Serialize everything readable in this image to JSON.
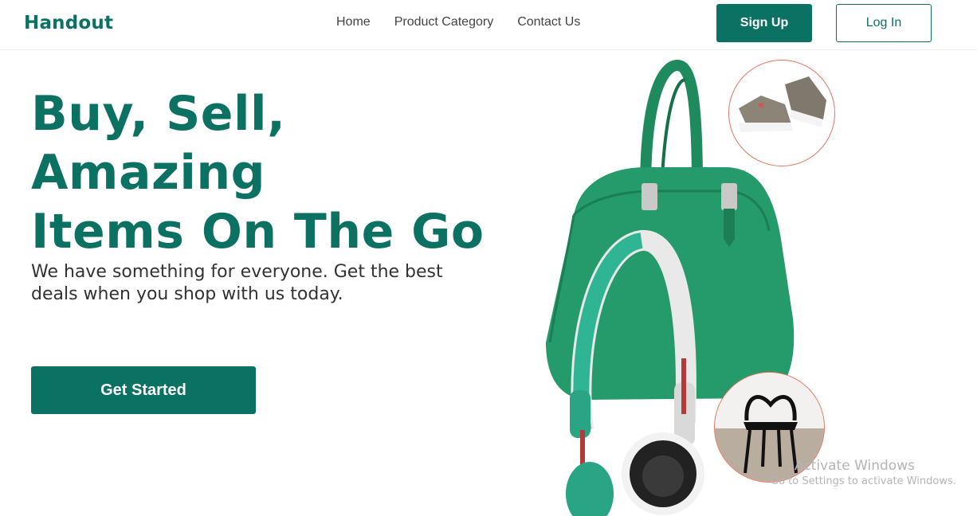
{
  "brand": {
    "name": "Handout",
    "color": "#0b7263"
  },
  "nav": {
    "items": [
      "Home",
      "Product Category",
      "Contact Us"
    ]
  },
  "auth": {
    "signup_label": "Sign Up",
    "login_label": "Log In"
  },
  "hero": {
    "title_line1": "Buy, Sell, Amazing",
    "title_line2": "Items On The Go",
    "subtitle_line1": "We have something for everyone. Get the best",
    "subtitle_line2": "deals when you shop with us today.",
    "cta_label": "Get Started"
  },
  "images": {
    "main": "green-handbag-with-headphones",
    "circle_top": "sneakers",
    "circle_bottom": "black-chair"
  },
  "watermark": {
    "title": "Activate Windows",
    "subtitle": "Go to Settings to activate Windows."
  }
}
